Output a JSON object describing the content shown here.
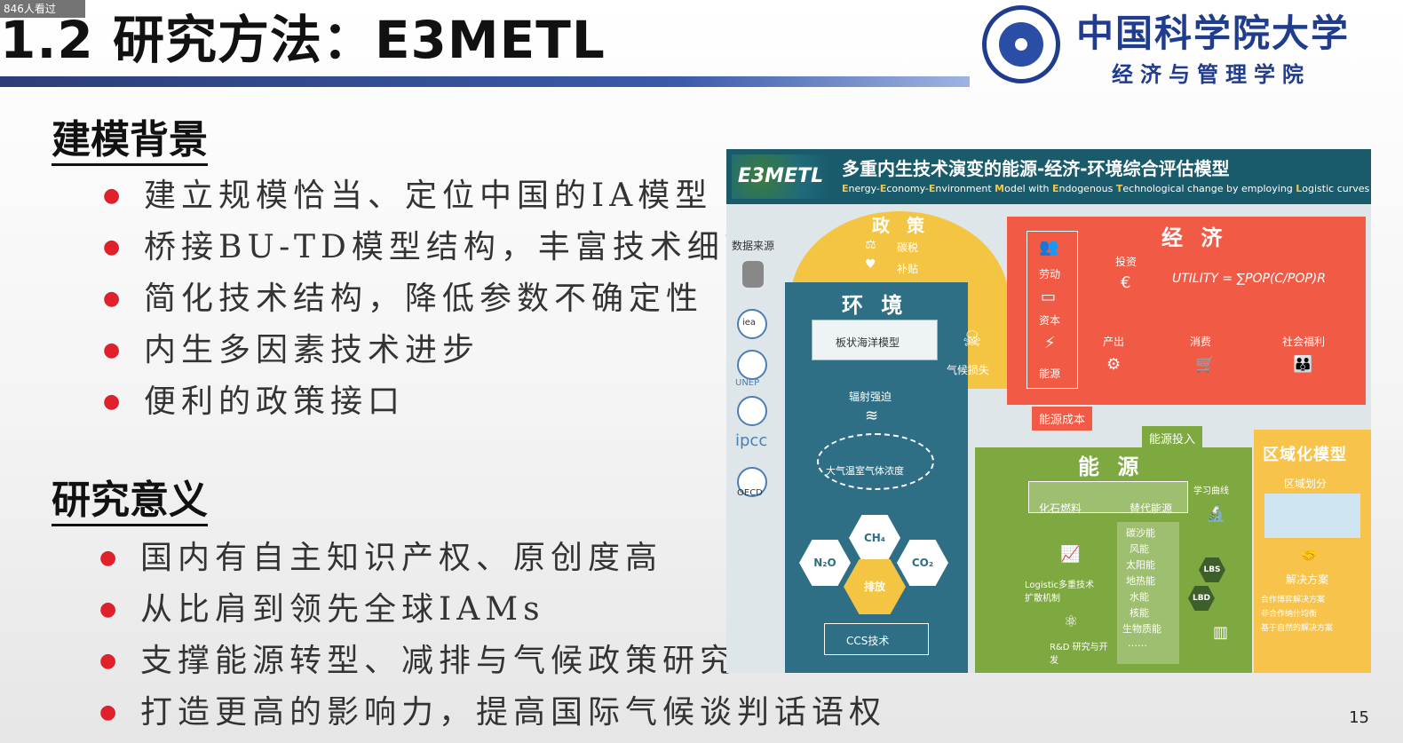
{
  "overlay": {
    "viewer_count": "846人看过"
  },
  "slide": {
    "title": "1.2 研究方法：E3METL",
    "page_number": "15",
    "colors": {
      "accent_bullet": "#e0202a",
      "title_bar": "#2c3e78",
      "logo_blue": "#1f3c8f"
    }
  },
  "logo": {
    "university": "中国科学院大学",
    "school": "经济与管理学院",
    "seal_icon": "ucas-seal-icon"
  },
  "sections": [
    {
      "heading": "建模背景",
      "bullets": [
        "建立规模恰当、定位中国的IA模型",
        "桥接BU-TD模型结构，丰富技术细节",
        "简化技术结构，降低参数不确定性",
        "内生多因素技术进步",
        "便利的政策接口"
      ]
    },
    {
      "heading": "研究意义",
      "bullets": [
        "国内有自主知识产权、原创度高",
        "从比肩到领先全球IAMs",
        "支撑能源转型、减排与气候政策研究",
        "打造更高的影响力，提高国际气候谈判话语权"
      ]
    }
  ],
  "diagram": {
    "logo_text": "E3METL",
    "title_zh": "多重内生技术演变的能源-经济-环境综合评估模型",
    "title_en_parts": [
      "E",
      "nergy-",
      "E",
      "conomy-",
      "E",
      "nvironment ",
      "M",
      "odel with ",
      "E",
      "ndogenous ",
      "T",
      "echnological change by employing ",
      "L",
      "ogistic curves"
    ],
    "data_sources": {
      "label": "数据来源",
      "items": [
        "iea",
        "UNEP",
        "ipcc",
        "OECD"
      ]
    },
    "policy": {
      "title": "政 策",
      "items": [
        "碳税",
        "补贴"
      ]
    },
    "environment": {
      "title": "环 境",
      "ocean_model": "板状海洋模型",
      "radiative_forcing": "辐射强迫",
      "ghg_concentration": "大气温室气体浓度",
      "gases": [
        "CH₄",
        "N₂O",
        "CO₂"
      ],
      "emission": "排放",
      "ccs": "CCS技术",
      "climate_loss": "气候损失"
    },
    "economy": {
      "title": "经 济",
      "inputs": [
        "劳动",
        "资本",
        "能源"
      ],
      "investment": "投资",
      "utility_formula": "UTILITY = ∑POP(C/POP)R",
      "flow": [
        "产出",
        "消费",
        "社会福利"
      ]
    },
    "energy": {
      "title": "能 源",
      "energy_cost": "能源成本",
      "energy_input": "能源投入",
      "fossil": "化石燃料",
      "alternative": "替代能源",
      "alternatives_list": [
        "碳沙能",
        "风能",
        "太阳能",
        "地热能",
        "水能",
        "核能",
        "生物质能",
        "……"
      ],
      "learning_curve": "学习曲线",
      "logistic": "Logistic多重技术扩散机制",
      "rnd": "R&D 研究与开发",
      "badges": [
        "LBS",
        "LBD"
      ]
    },
    "regional": {
      "title": "区域化模型",
      "division": "区域划分",
      "solutions_title": "解决方案",
      "solutions": [
        "合作博弈解决方案",
        "非合作纳什均衡",
        "基于自然的解决方案"
      ]
    }
  }
}
